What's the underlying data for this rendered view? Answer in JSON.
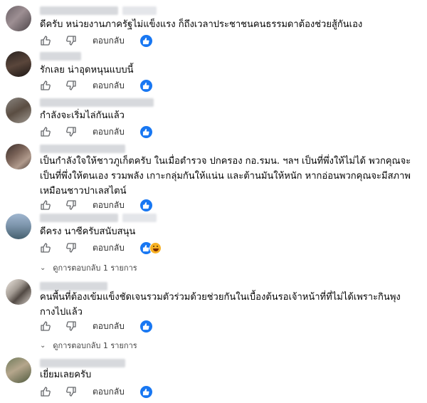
{
  "actions": {
    "reply_label": "ตอบกลับ"
  },
  "comments": [
    {
      "text": "ดีครับ หน่วยงานภาครัฐไม่แข็งแรง ก็ถึงเวลาประชาชนคนธรรมดาต้องช่วยสู้กันเอง",
      "reactions": [
        "like"
      ]
    },
    {
      "text": "รักเลย น่าอุดหนุนแบบนี้",
      "reactions": [
        "like"
      ]
    },
    {
      "text": "กำลังจะเริ่มไล่กันแล้ว",
      "reactions": [
        "like"
      ]
    },
    {
      "text": "เป็นกำลังใจให้ชาวภูเก็ตครับ ในเมื่อตำรวจ ปกครอง กอ.รมน. ฯลฯ เป็นที่พึ่งให้ไม่ได้ พวกคุณจะเป็นที่พึ่งให้ตนเอง รวมพลัง เกาะกลุ่มกันให้แน่น และต้านมันให้หนัก หากอ่อนพวกคุณจะมีสภาพเหมือนชาวปาเลสไตน์",
      "reactions": [
        "like"
      ]
    },
    {
      "text": "ดีครง นาซีครับสนับสนุน",
      "reactions": [
        "like",
        "haha"
      ],
      "replies_label": "ดูการตอบกลับ 1 รายการ"
    },
    {
      "text": "คนพื้นที่ต้องเข้มแข็งชัดเจนรวมตัวร่วมด้วยช่วยกันในเบื้องต้นรอเจ้าหน้าที่ที่ไม่ได้เพราะกินพุงกางไปแล้ว",
      "reactions": [
        "like"
      ],
      "replies_label": "ดูการตอบกลับ 1 รายการ"
    },
    {
      "text": "เยี่ยมเลยครับ",
      "reactions": [
        "like"
      ]
    }
  ],
  "colors": {
    "like_blue": "#1877f2",
    "haha_yellow": "#f7b125",
    "icon_gray": "#65676b"
  }
}
